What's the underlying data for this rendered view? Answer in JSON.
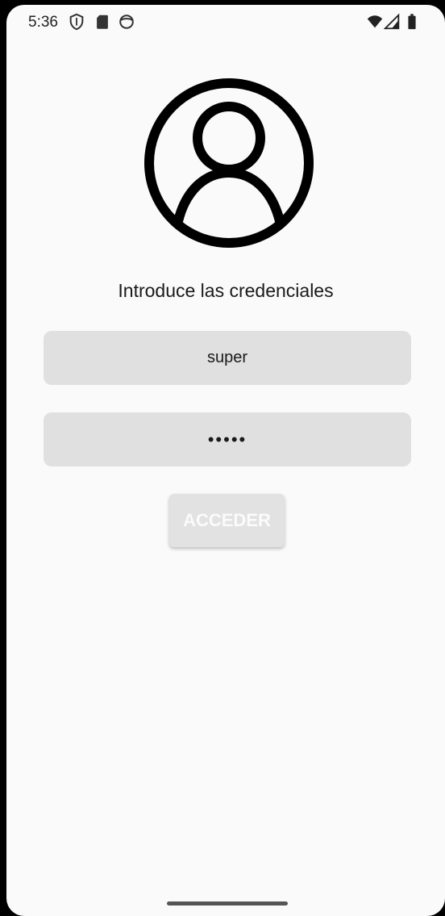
{
  "status_bar": {
    "time": "5:36",
    "left_icons": [
      "shield-icon",
      "sd-card-icon",
      "face-icon"
    ],
    "right_icons": [
      "wifi-icon",
      "signal-icon",
      "battery-icon"
    ]
  },
  "login": {
    "avatar_icon": "account-circle-icon",
    "subtitle": "Introduce las credenciales",
    "username_value": "super",
    "password_value": "•••••",
    "submit_label": "ACCEDER"
  },
  "colors": {
    "background": "#fafafa",
    "field_background": "#e0e0e0",
    "button_background": "#e2e2e2",
    "button_text": "#fbfbfb",
    "text": "#1a1a1a"
  }
}
